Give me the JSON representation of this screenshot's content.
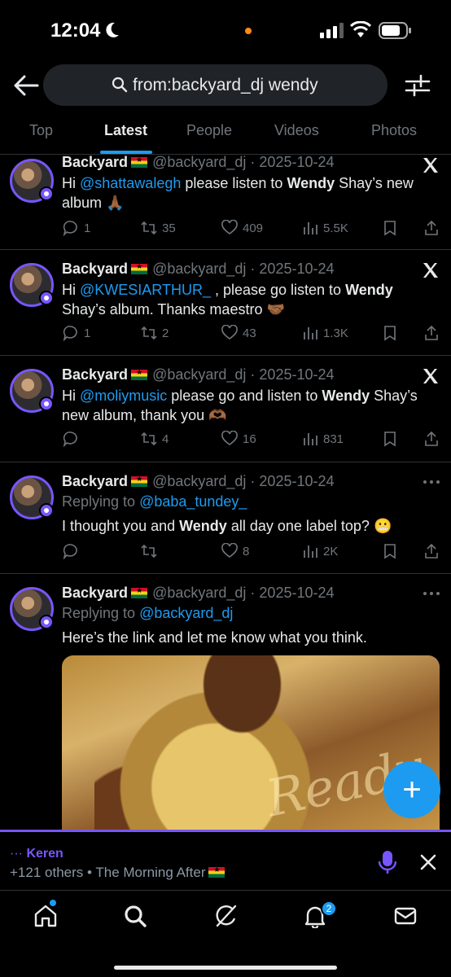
{
  "status_bar": {
    "time": "12:04"
  },
  "search": {
    "query": "from:backyard_dj wendy"
  },
  "tabs": [
    {
      "label": "Top",
      "active": false
    },
    {
      "label": "Latest",
      "active": true
    },
    {
      "label": "People",
      "active": false
    },
    {
      "label": "Videos",
      "active": false
    },
    {
      "label": "Photos",
      "active": false
    }
  ],
  "tweets": [
    {
      "name": "Backyard",
      "handle": "@backyard_dj",
      "date": "· 2025-10-24",
      "text_pre": "Hi ",
      "mention": "@shattawalegh",
      "text_mid": " please listen to ",
      "bold": "Wendy",
      "text_post": " Shay’s new album 🙏🏾",
      "replies": "1",
      "retweets": "35",
      "likes": "409",
      "views": "5.5K"
    },
    {
      "name": "Backyard",
      "handle": "@backyard_dj",
      "date": "· 2025-10-24",
      "text_pre": "Hi ",
      "mention": "@KWESIARTHUR_",
      "text_mid": " , please go listen to ",
      "bold": "Wendy",
      "text_post": " Shay’s album. Thanks maestro 🤝🏾",
      "replies": "1",
      "retweets": "2",
      "likes": "43",
      "views": "1.3K"
    },
    {
      "name": "Backyard",
      "handle": "@backyard_dj",
      "date": "· 2025-10-24",
      "text_pre": "Hi ",
      "mention": "@moliymusic",
      "text_mid": " please go and listen to ",
      "bold": "Wendy",
      "text_post": " Shay’s new album, thank you 🫶🏾",
      "replies": "",
      "retweets": "4",
      "likes": "16",
      "views": "831"
    },
    {
      "name": "Backyard",
      "handle": "@backyard_dj",
      "date": "· 2025-10-24",
      "reply_label": "Replying to ",
      "reply_to": "@baba_tundey_",
      "text_pre": "I thought you and ",
      "bold": "Wendy",
      "text_post": " all day one label top? 😬",
      "replies": "",
      "retweets": "",
      "likes": "8",
      "views": "2K"
    },
    {
      "name": "Backyard",
      "handle": "@backyard_dj",
      "date": "· 2025-10-24",
      "reply_label": "Replying to ",
      "reply_to": "@backyard_dj",
      "text_pre": "Here’s the link and let me know what you think.",
      "media_script": "Ready"
    }
  ],
  "spaces": {
    "host": "Keren",
    "subtitle": "+121 others • The Morning After"
  },
  "nav": {
    "notifications_badge": "2"
  },
  "colors": {
    "accent": "#1d9bf0",
    "spaces": "#7856ff",
    "background": "#000000"
  }
}
